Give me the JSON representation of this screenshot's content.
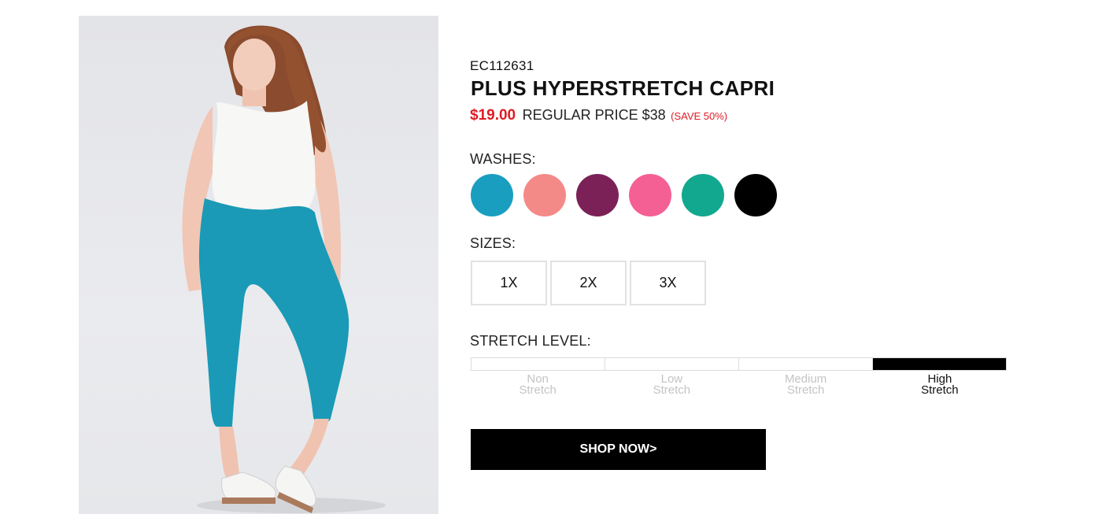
{
  "product": {
    "sku": "EC112631",
    "title": "PLUS HYPERSTRETCH CAPRI",
    "sale_price": "$19.00",
    "regular_price": "REGULAR PRICE $38",
    "save": "(SAVE 50%)"
  },
  "washes": {
    "label": "WASHES:",
    "colors": [
      {
        "name": "teal-blue",
        "hex": "#1a9ec0"
      },
      {
        "name": "coral",
        "hex": "#f48a87"
      },
      {
        "name": "plum",
        "hex": "#7b2158"
      },
      {
        "name": "pink",
        "hex": "#f45f94"
      },
      {
        "name": "jade",
        "hex": "#12a88f"
      },
      {
        "name": "black",
        "hex": "#000000"
      }
    ]
  },
  "sizes": {
    "label": "SIZES:",
    "options": [
      "1X",
      "2X",
      "3X"
    ]
  },
  "stretch": {
    "label": "STRETCH LEVEL:",
    "levels": [
      {
        "line1": "Non",
        "line2": "Stretch"
      },
      {
        "line1": "Low",
        "line2": "Stretch"
      },
      {
        "line1": "Medium",
        "line2": "Stretch"
      },
      {
        "line1": "High",
        "line2": "Stretch"
      }
    ],
    "active_index": 3
  },
  "cta": {
    "label": "SHOP NOW>"
  },
  "colors": {
    "sale_red": "#e01b24",
    "black": "#000000",
    "border": "#e2e2e2"
  }
}
